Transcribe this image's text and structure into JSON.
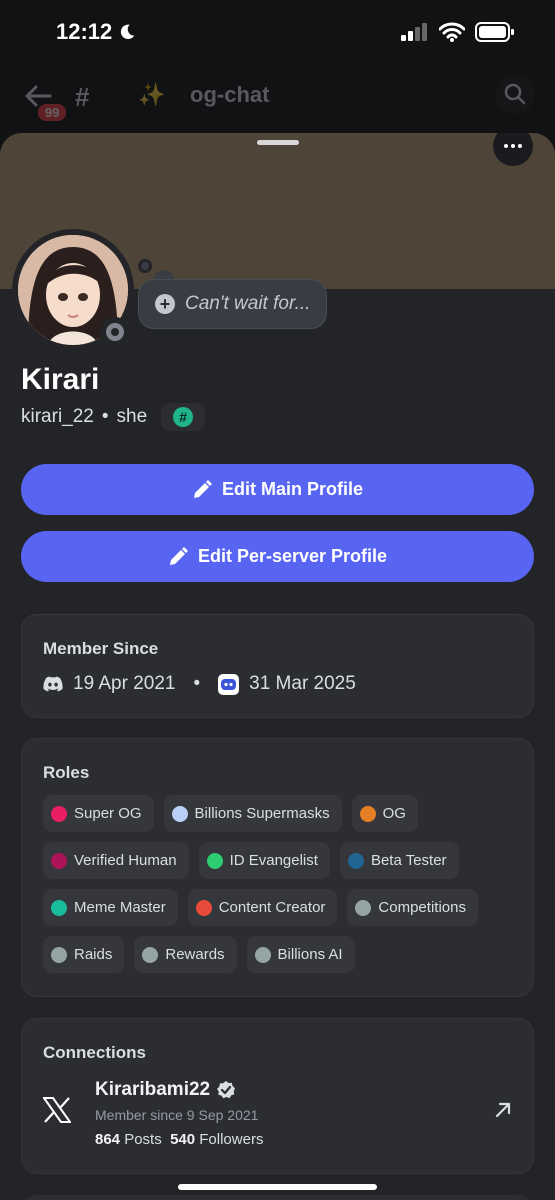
{
  "status_bar": {
    "time": "12:12"
  },
  "channel_header": {
    "unread_badge": "99",
    "channel_name": "og-chat"
  },
  "profile": {
    "custom_status_placeholder": "Can't wait for...",
    "display_name": "Kirari",
    "username": "kirari_22",
    "pronouns": "she",
    "separator": "•"
  },
  "buttons": {
    "edit_main": "Edit Main Profile",
    "edit_server": "Edit Per-server Profile"
  },
  "member_since": {
    "title": "Member Since",
    "discord_date": "19 Apr 2021",
    "server_date": "31 Mar 2025"
  },
  "roles": {
    "title": "Roles",
    "items": [
      {
        "label": "Super OG",
        "color": "#e91e63"
      },
      {
        "label": "Billions Supermasks",
        "color": "#b9cff5"
      },
      {
        "label": "OG",
        "color": "#e67e22"
      },
      {
        "label": "Verified Human",
        "color": "#ad1457"
      },
      {
        "label": "ID Evangelist",
        "color": "#2ecc71"
      },
      {
        "label": "Beta Tester",
        "color": "#206694"
      },
      {
        "label": "Meme Master",
        "color": "#1abc9c"
      },
      {
        "label": "Content Creator",
        "color": "#e74c3c"
      },
      {
        "label": "Competitions",
        "color": "#95a5a6"
      },
      {
        "label": "Raids",
        "color": "#95a5a6"
      },
      {
        "label": "Rewards",
        "color": "#95a5a6"
      },
      {
        "label": "Billions AI",
        "color": "#95a5a6"
      }
    ]
  },
  "connections": {
    "title": "Connections",
    "account": {
      "name": "Kiraribami22",
      "since": "Member since 9 Sep 2021",
      "posts_count": "864",
      "posts_label": "Posts",
      "followers_count": "540",
      "followers_label": "Followers"
    }
  },
  "colors": {
    "blurple": "#5865f2",
    "card": "#2b2d31",
    "banner": "#4f4438"
  }
}
